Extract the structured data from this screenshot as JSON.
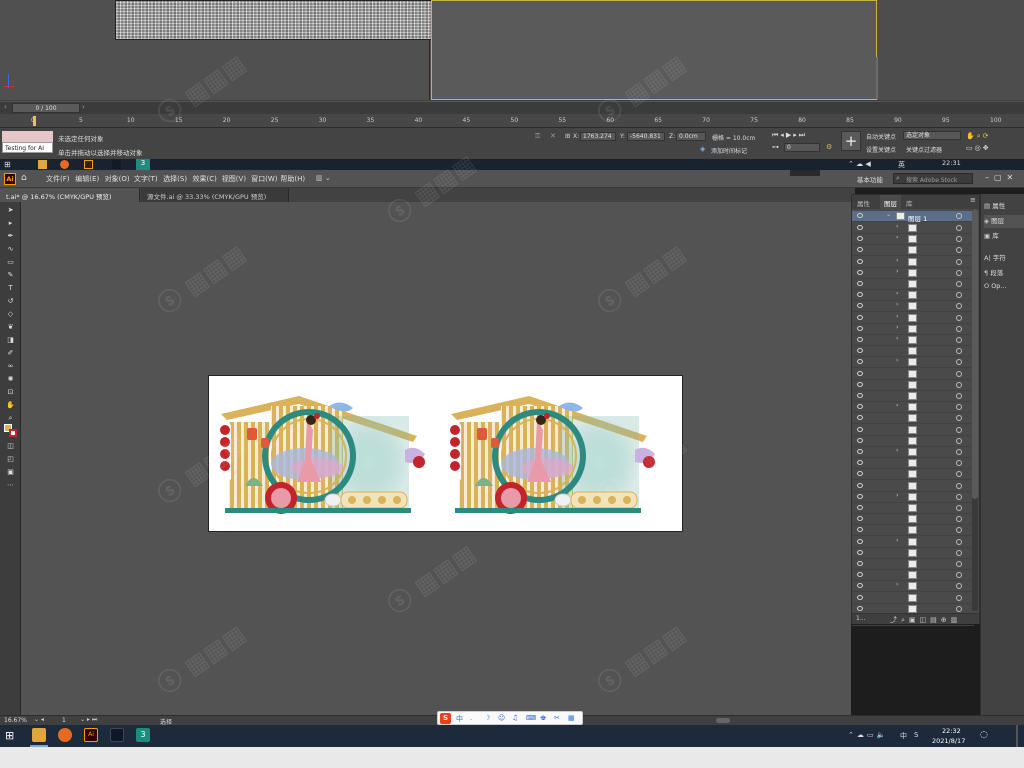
{
  "max": {
    "frame_counter": "0 / 100",
    "ruler_ticks": [
      "0",
      "5",
      "10",
      "15",
      "20",
      "25",
      "30",
      "35",
      "40",
      "45",
      "50",
      "55",
      "60",
      "65",
      "70",
      "75",
      "80",
      "85",
      "90",
      "95",
      "100"
    ],
    "status_line1": "未选定任何对象",
    "status_line2": "单击并拖动以选择并移动对象",
    "script_label": "Testing for AI",
    "coord_x_label": "X:",
    "coord_x": "1763.274",
    "coord_y_label": "Y:",
    "coord_y": "-5640.831",
    "coord_z_label": "Z:",
    "coord_z": "0.0cm",
    "grid": "栅格 = 10.0cm",
    "add_time_tag": "添加时间标记",
    "auto_key": "自动关键点",
    "selected_object": "选定对象",
    "set_key": "设置关键点",
    "key_filter": "关键点过滤器",
    "frame_field": "0"
  },
  "win_top": {
    "lang": "英",
    "time": "22:31"
  },
  "ai": {
    "logo": "Ai",
    "menus": [
      "文件(F)",
      "编辑(E)",
      "对象(O)",
      "文字(T)",
      "选择(S)",
      "效果(C)",
      "视图(V)",
      "窗口(W)",
      "帮助(H)"
    ],
    "workspace": "基本功能",
    "search_placeholder": "搜索 Adobe Stock",
    "tabs": [
      {
        "label": "t.ai* @ 16.67% (CMYK/GPU 预览)",
        "active": true
      },
      {
        "label": "源文件.ai @ 33.33% (CMYK/GPU 预览)",
        "active": false
      }
    ],
    "zoom": "16.67%",
    "artboard_num": "1",
    "status_tool": "选择"
  },
  "layers_panel": {
    "tabs": [
      "属性",
      "图层",
      "库"
    ],
    "layer_name": "图层 1",
    "row_count": 36
  },
  "right_panel": {
    "items": [
      "属性",
      "图层",
      "库",
      "字符",
      "段落",
      "Op..."
    ]
  },
  "ime": {
    "items": [
      "中",
      ".",
      "☽",
      "☺",
      "♫",
      "⌨",
      "♚",
      "✂",
      "▦"
    ]
  },
  "taskbar": {
    "lang": "中",
    "time": "22:32",
    "date": "2021/8/17"
  },
  "artwork": {
    "colors": {
      "gold": "#d9b25a",
      "teal": "#2d8a80",
      "red": "#c2242c",
      "pink": "#e89aa8",
      "blue": "#7fb8d6"
    }
  }
}
